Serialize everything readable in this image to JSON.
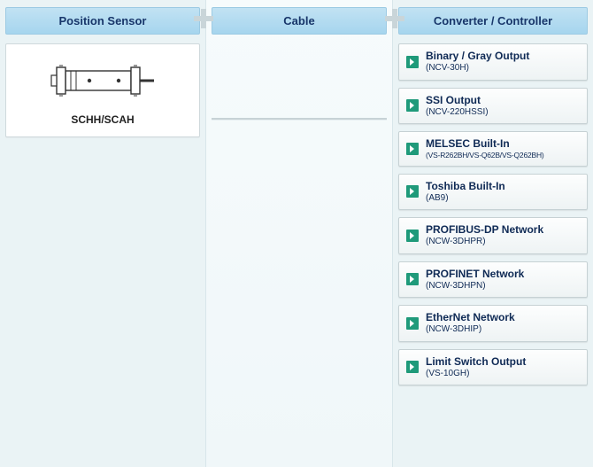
{
  "columns": {
    "sensor": {
      "header": "Position Sensor"
    },
    "cable": {
      "header": "Cable"
    },
    "converter": {
      "header": "Converter / Controller"
    }
  },
  "sensor": {
    "label": "SCHH/SCAH"
  },
  "converters": [
    {
      "title": "Binary / Gray Output",
      "sub": "(NCV-30H)",
      "small": false
    },
    {
      "title": "SSI Output",
      "sub": "(NCV-220HSSI)",
      "small": false
    },
    {
      "title": "MELSEC Built-In",
      "sub": "(VS-R262BH/VS-Q62B/VS-Q262BH)",
      "small": true
    },
    {
      "title": "Toshiba Built-In",
      "sub": "(AB9)",
      "small": false
    },
    {
      "title": "PROFIBUS-DP Network",
      "sub": "(NCW-3DHPR)",
      "small": false
    },
    {
      "title": "PROFINET Network",
      "sub": "(NCW-3DHPN)",
      "small": false
    },
    {
      "title": "EtherNet Network",
      "sub": "(NCW-3DHIP)",
      "small": false
    },
    {
      "title": "Limit Switch Output",
      "sub": "(VS-10GH)",
      "small": false
    }
  ]
}
